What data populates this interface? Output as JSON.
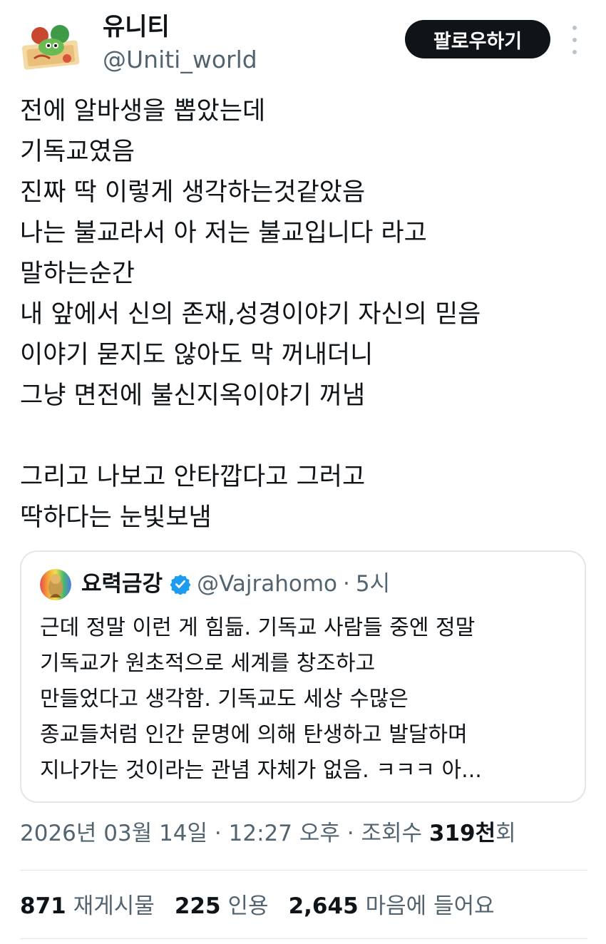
{
  "author": {
    "name": "유니티",
    "handle": "@Uniti_world"
  },
  "follow_button": "팔로우하기",
  "tweet_lines": [
    "전에 알바생을 뽑았는데",
    "기독교였음",
    "진짜 딱 이렇게 생각하는것같았음",
    "나는 불교라서 아 저는 불교입니다 라고",
    "말하는순간",
    "내 앞에서 신의 존재,성경이야기 자신의 믿음",
    "이야기 묻지도 않아도 막 꺼내더니",
    "그냥 면전에 불신지옥이야기 꺼냄",
    "",
    "그리고 나보고 안타깝다고 그러고",
    "딱하다는 눈빛보냄"
  ],
  "quote": {
    "name": "요력금강",
    "handle": "@Vajrahomo",
    "separator": "·",
    "time": "5시",
    "lines": [
      "근데 정말 이런 게 힘듦. 기독교 사람들 중엔 정말",
      "기독교가 원초적으로 세계를 창조하고",
      "만들었다고 생각함. 기독교도 세상 수많은",
      "종교들처럼 인간 문명에 의해 탄생하고 발달하며",
      "지나가는 것이라는 관념 자체가 없음. ㅋㅋㅋ 아..."
    ]
  },
  "meta": {
    "date": "2026년 03월 14일",
    "sep1": "·",
    "time": "12:27 오후",
    "sep2": "·",
    "views_label": "조회수",
    "views_value": "319천",
    "views_suffix": "회"
  },
  "stats": {
    "reposts_value": "871",
    "reposts_label": "재게시물",
    "quotes_value": "225",
    "quotes_label": "인용",
    "likes_value": "2,645",
    "likes_label": "마음에 들어요"
  },
  "colors": {
    "primary_text": "#0f1419",
    "secondary_text": "#536471",
    "border": "#e3e7ea",
    "verified": "#1d9bf0"
  }
}
